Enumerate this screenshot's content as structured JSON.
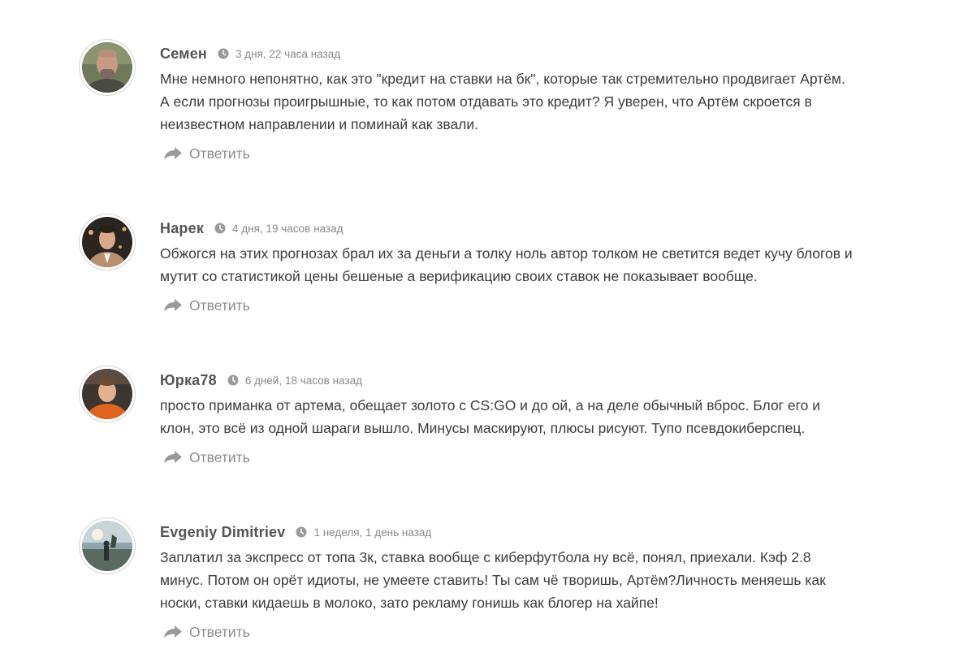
{
  "comments": [
    {
      "author": "Семен",
      "date": "3 дня, 22 часа назад",
      "text": "Мне немного непонятно, как это \"кредит на ставки на бк\", которые так стремительно продвигает Артём. А если прогнозы проигрышные, то как потом отдавать это кредит? Я уверен, что Артём скроется в неизвестном направлении и поминай как звали.",
      "reply_label": "Ответить"
    },
    {
      "author": "Нарек",
      "date": "4 дня, 19 часов назад",
      "text": "Обжогся на этих прогнозах брал их за деньги а толку ноль автор толком не светится ведет кучу блогов и мутит со статистикой цены бешеные а верификацию своих ставок не показывает вообще.",
      "reply_label": "Ответить"
    },
    {
      "author": "Юрка78",
      "date": "6 дней, 18 часов назад",
      "text": "просто приманка от артема, обещает золото с CS:GO и до ой, а на деле обычный вброс. Блог его и клон, это всё из одной шараги вышло. Минусы маскируют, плюсы рисуют. Тупо псевдокиберспец.",
      "reply_label": "Ответить"
    },
    {
      "author": "Evgeniy Dimitriev",
      "date": "1 неделя, 1 день назад",
      "text": "Заплатил за экспресс от топа 3к, ставка вообще с киберфутбола ну всё, понял, приехали. Кэф 2.8 минус. Потом он орёт идиоты, не умеете ставить! Ты сам чё творишь, Артём?Личность меняешь как носки, ставки кидаешь в молоко, зато рекламу гонишь как блогер на хайпе!",
      "reply_label": "Ответить"
    }
  ],
  "icons": {
    "clock": "clock-icon",
    "reply": "reply-arrow-icon"
  },
  "colors": {
    "author": "#555555",
    "date": "#8a8a8a",
    "text": "#3c3c3c",
    "reply": "#8c8c8c",
    "icon": "#9a9a9a"
  }
}
